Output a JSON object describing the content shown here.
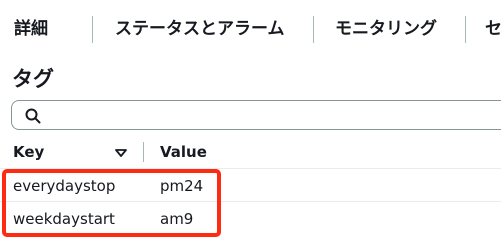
{
  "tabs": [
    {
      "label": "詳細"
    },
    {
      "label": "ステータスとアラーム"
    },
    {
      "label": "モニタリング"
    },
    {
      "label": "セ"
    }
  ],
  "section": {
    "title": "タグ"
  },
  "search": {
    "placeholder": "",
    "value": "",
    "icon": "search-icon"
  },
  "table": {
    "columns": [
      "Key",
      "Value"
    ],
    "sort_icon": "sort-descending-icon",
    "rows": [
      {
        "key": "everydaystop",
        "value": "pm24"
      },
      {
        "key": "weekdaystart",
        "value": "am9"
      }
    ]
  },
  "colors": {
    "highlight": "#ff2a12",
    "border": "#879596",
    "text": "#16191f"
  }
}
